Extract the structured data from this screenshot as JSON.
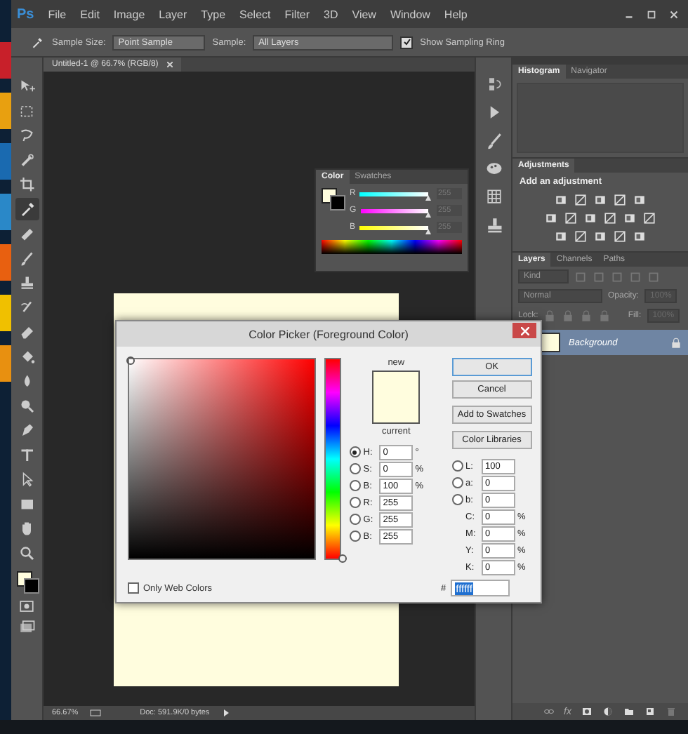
{
  "app": {
    "logo": "Ps"
  },
  "menu": [
    "File",
    "Edit",
    "Image",
    "Layer",
    "Type",
    "Select",
    "Filter",
    "3D",
    "View",
    "Window",
    "Help"
  ],
  "options_bar": {
    "sample_size_label": "Sample Size:",
    "sample_size": "Point Sample",
    "sample_label": "Sample:",
    "sample": "All Layers",
    "show_sampling_ring": {
      "label": "Show Sampling Ring",
      "checked": true
    }
  },
  "tools": [
    {
      "kind": "move",
      "selected": false
    },
    {
      "kind": "marquee",
      "selected": false
    },
    {
      "kind": "lasso",
      "selected": false
    },
    {
      "kind": "quick-select",
      "selected": false
    },
    {
      "kind": "crop",
      "selected": false
    },
    {
      "kind": "eyedropper",
      "selected": true
    },
    {
      "kind": "healing",
      "selected": false
    },
    {
      "kind": "brush",
      "selected": false
    },
    {
      "kind": "stamp",
      "selected": false
    },
    {
      "kind": "history-brush",
      "selected": false
    },
    {
      "kind": "eraser",
      "selected": false
    },
    {
      "kind": "bucket",
      "selected": false
    },
    {
      "kind": "blur",
      "selected": false
    },
    {
      "kind": "dodge",
      "selected": false
    },
    {
      "kind": "pen",
      "selected": false
    },
    {
      "kind": "type",
      "selected": false
    },
    {
      "kind": "path-select",
      "selected": false
    },
    {
      "kind": "shape",
      "selected": false
    },
    {
      "kind": "hand",
      "selected": false
    },
    {
      "kind": "zoom",
      "selected": false
    }
  ],
  "document": {
    "tab_title": "Untitled-1 @ 66.7% (RGB/8)"
  },
  "status_bar": {
    "zoom": "66.67%",
    "doc": "Doc: 591.9K/0 bytes"
  },
  "color_panel": {
    "tabs": [
      {
        "label": "Color",
        "selected": true
      },
      {
        "label": "Swatches",
        "selected": false
      }
    ],
    "channels": [
      {
        "name": "R",
        "level": 1,
        "reading": "255"
      },
      {
        "name": "G",
        "level": 1,
        "reading": "255"
      },
      {
        "name": "B",
        "level": 1,
        "reading": "255"
      }
    ]
  },
  "histogram_panel": {
    "tabs": [
      {
        "label": "Histogram",
        "selected": true
      },
      {
        "label": "Navigator",
        "selected": false
      }
    ]
  },
  "adjustments_panel": {
    "tabs": [
      {
        "label": "Adjustments",
        "selected": true
      }
    ],
    "heading": "Add an adjustment"
  },
  "layers_panel": {
    "tabs": [
      {
        "label": "Layers",
        "selected": true
      },
      {
        "label": "Channels",
        "selected": false
      },
      {
        "label": "Paths",
        "selected": false
      }
    ],
    "filter": "Kind",
    "blend_mode": "Normal",
    "opacity_label": "Opacity:",
    "opacity": {
      "value": "100%",
      "disabled": true
    },
    "lock_label": "Lock:",
    "fill_label": "Fill:",
    "fill": {
      "value": "100%",
      "disabled": true
    },
    "layers": [
      {
        "name": "Background",
        "selected": true
      }
    ],
    "fx_label": "fx"
  },
  "dialog": {
    "title": "Color Picker (Foreground Color)",
    "new_label": "new",
    "current_label": "current",
    "buttons": [
      "OK",
      "Cancel",
      "Add to Swatches",
      "Color Libraries"
    ],
    "left_fields": [
      {
        "kind": "radio",
        "label": "H:",
        "value": "0",
        "unit": "°",
        "selected": true
      },
      {
        "kind": "radio",
        "label": "S:",
        "value": "0",
        "unit": "%",
        "selected": false
      },
      {
        "kind": "radio",
        "label": "B:",
        "value": "100",
        "unit": "%",
        "selected": false
      },
      {
        "kind": "radio",
        "label": "R:",
        "value": "255",
        "selected": false
      },
      {
        "kind": "radio",
        "label": "G:",
        "value": "255",
        "selected": false
      },
      {
        "kind": "radio",
        "label": "B:",
        "value": "255",
        "selected": false
      }
    ],
    "right_fields": [
      {
        "kind": "radio",
        "label": "L:",
        "value": "100",
        "selected": false
      },
      {
        "kind": "radio",
        "label": "a:",
        "value": "0",
        "selected": false
      },
      {
        "kind": "radio",
        "label": "b:",
        "value": "0",
        "selected": false
      },
      {
        "kind": "plain",
        "label": "C:",
        "value": "0",
        "unit": "%"
      },
      {
        "kind": "plain",
        "label": "M:",
        "value": "0",
        "unit": "%"
      },
      {
        "kind": "plain",
        "label": "Y:",
        "value": "0",
        "unit": "%"
      },
      {
        "kind": "plain",
        "label": "K:",
        "value": "0",
        "unit": "%"
      }
    ],
    "only_web_colors": {
      "label": "Only Web Colors",
      "checked": false
    },
    "hex_label": "#",
    "hex": "ffffff",
    "hue_slider": {
      "level": 0
    }
  }
}
